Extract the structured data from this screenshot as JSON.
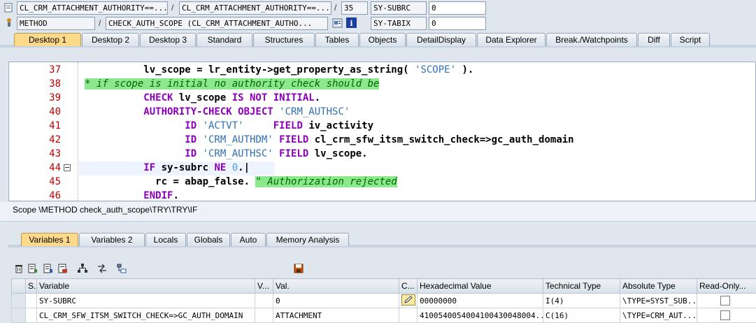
{
  "top": {
    "row1": {
      "field_a": "CL_CRM_ATTACHMENT_AUTHORITY==...",
      "sep1": "/",
      "field_b": "CL_CRM_ATTACHMENT_AUTHORITY==...",
      "sep2": "/",
      "line_no": "35",
      "sysvar_name": "SY-SUBRC",
      "sysvar_value": "0"
    },
    "row2": {
      "type": "METHOD",
      "sep": "/",
      "method": "CHECK_AUTH_SCOPE (CL_CRM_ATTACHMENT_AUTHO...",
      "sysvar_name": "SY-TABIX",
      "sysvar_value": "0"
    }
  },
  "desktop_tabs": [
    "Desktop 1",
    "Desktop 2",
    "Desktop 3",
    "Standard",
    "Structures",
    "Tables",
    "Objects",
    "DetailDisplay",
    "Data Explorer",
    "Break./Watchpoints",
    "Diff",
    "Script"
  ],
  "code_lines": [
    {
      "no": "37",
      "parts": [
        [
          "",
          "          lv_scope = lr_entity->get_property_as_string( "
        ],
        [
          "str",
          "'SCOPE'"
        ],
        [
          "",
          " )."
        ]
      ]
    },
    {
      "no": "38",
      "parts": [
        [
          "cmt",
          "* if scope is initial no authority check should be"
        ]
      ]
    },
    {
      "no": "39",
      "parts": [
        [
          "kw",
          "          CHECK "
        ],
        [
          "",
          "lv_scope "
        ],
        [
          "kw",
          "IS NOT INITIAL"
        ],
        [
          "",
          "."
        ]
      ]
    },
    {
      "no": "40",
      "parts": [
        [
          "kw",
          "          AUTHORITY-CHECK OBJECT "
        ],
        [
          "str",
          "'CRM_AUTHSC'"
        ]
      ]
    },
    {
      "no": "41",
      "parts": [
        [
          "kw",
          "                 ID "
        ],
        [
          "str",
          "'ACTVT'    "
        ],
        [
          "kw",
          " FIELD "
        ],
        [
          "",
          "iv_activity"
        ]
      ]
    },
    {
      "no": "42",
      "parts": [
        [
          "kw",
          "                 ID "
        ],
        [
          "str",
          "'CRM_AUTHDM'"
        ],
        [
          "kw",
          " FIELD "
        ],
        [
          "",
          "cl_crm_sfw_itsm_switch_check=>gc_auth_domain"
        ]
      ]
    },
    {
      "no": "43",
      "parts": [
        [
          "kw",
          "                 ID "
        ],
        [
          "str",
          "'CRM_AUTHSC'"
        ],
        [
          "kw",
          " FIELD "
        ],
        [
          "",
          "lv_scope."
        ]
      ]
    },
    {
      "no": "44",
      "parts": [
        [
          "kw",
          "          IF "
        ],
        [
          "",
          "sy-subrc "
        ],
        [
          "kw",
          "NE "
        ],
        [
          "num",
          "0"
        ],
        [
          "",
          ".|"
        ]
      ]
    },
    {
      "no": "45",
      "parts": [
        [
          "",
          "            rc = abap_false. "
        ],
        [
          "cmt",
          "\" Authorization rejected"
        ]
      ]
    },
    {
      "no": "46",
      "parts": [
        [
          "kw",
          "          ENDIF"
        ],
        [
          "",
          "."
        ]
      ]
    }
  ],
  "scope_text": "Scope \\METHOD check_auth_scope\\TRY\\TRY\\IF",
  "variable_tabs": [
    "Variables 1",
    "Variables 2",
    "Locals",
    "Globals",
    "Auto",
    "Memory Analysis"
  ],
  "table": {
    "headers": [
      "S...",
      "Variable",
      "V...",
      "Val.",
      "C...",
      "Hexadecimal Value",
      "Technical Type",
      "Absolute Type",
      "Read-Only..."
    ],
    "rows": [
      [
        "",
        "SY-SUBRC",
        "",
        "0",
        "",
        "00000000",
        "I(4)",
        "\\TYPE=SYST_SUB...",
        ""
      ],
      [
        "",
        "CL_CRM_SFW_ITSM_SWITCH_CHECK=>GC_AUTH_DOMAIN",
        "",
        "ATTACHMENT",
        "",
        "4100540054004100430048004...",
        "C(16)",
        "\\TYPE=CRM_AUT...",
        ""
      ]
    ]
  },
  "icons": [
    "delete-icon",
    "new-icon",
    "change-icon",
    "save-layout-icon",
    "hierarchy-icon",
    "transfer-icon",
    "tree-icon",
    "save-icon",
    "pencil-icon"
  ],
  "colors": {
    "active_tab": "#fdd98a",
    "comment_bg": "#8ce88c",
    "keyword": "#8b00b8",
    "line_no": "#c00000",
    "string": "#2f6fb8"
  }
}
